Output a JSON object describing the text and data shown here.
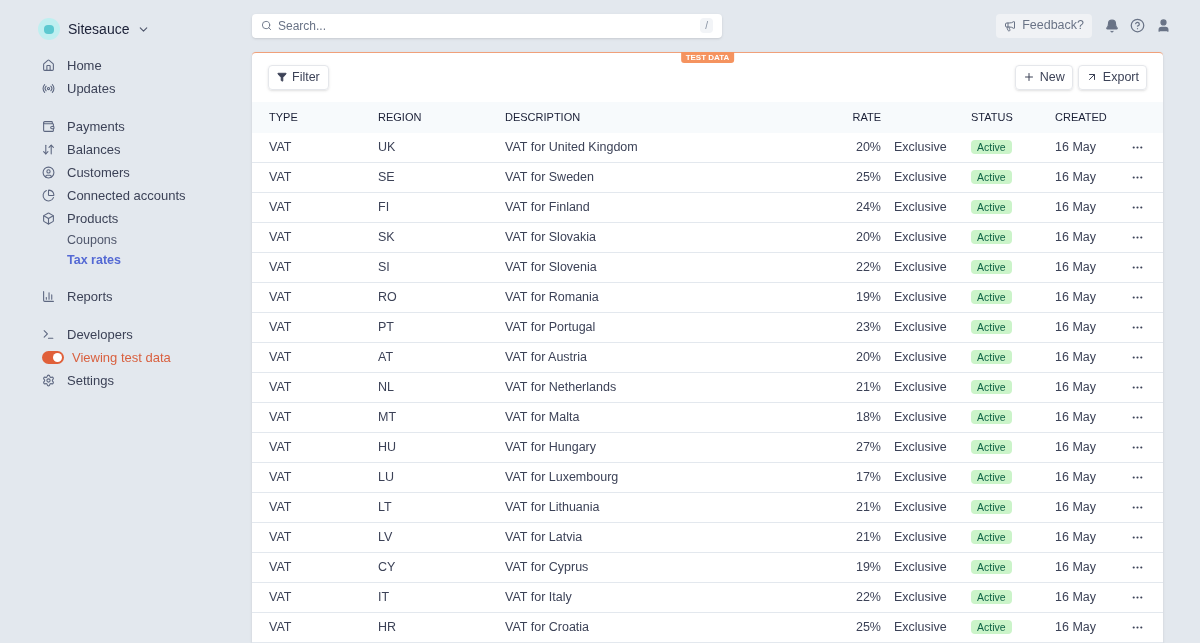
{
  "brand": {
    "name": "Sitesauce"
  },
  "sidebar": {
    "groups": [
      {
        "items": [
          {
            "label": "Home",
            "kind": "main",
            "selected": false
          },
          {
            "label": "Updates",
            "kind": "main",
            "selected": false
          }
        ]
      },
      {
        "items": [
          {
            "label": "Payments",
            "kind": "main",
            "selected": false
          },
          {
            "label": "Balances",
            "kind": "main",
            "selected": false
          },
          {
            "label": "Customers",
            "kind": "main",
            "selected": false
          },
          {
            "label": "Connected accounts",
            "kind": "main",
            "selected": false
          },
          {
            "label": "Products",
            "kind": "main",
            "selected": false
          },
          {
            "label": "Coupons",
            "kind": "sub",
            "selected": false
          },
          {
            "label": "Tax rates",
            "kind": "sub",
            "selected": true
          }
        ]
      },
      {
        "items": [
          {
            "label": "Reports",
            "kind": "main",
            "selected": false
          }
        ]
      },
      {
        "items": [
          {
            "label": "Developers",
            "kind": "main",
            "selected": false
          },
          {
            "label": "Viewing test data",
            "kind": "toggle",
            "on": true,
            "selected": false
          },
          {
            "label": "Settings",
            "kind": "main",
            "selected": false
          }
        ]
      }
    ]
  },
  "search": {
    "placeholder": "Search...",
    "shortcut": "/"
  },
  "topbar": {
    "feedback": "Feedback?"
  },
  "card": {
    "badge": "TEST DATA",
    "filter": "Filter",
    "new": "New",
    "export": "Export"
  },
  "table": {
    "columns": [
      "TYPE",
      "REGION",
      "DESCRIPTION",
      "RATE",
      "STATUS",
      "CREATED"
    ],
    "rows": [
      {
        "type": "VAT",
        "region": "UK",
        "description": "VAT for United Kingdom",
        "rate": "20%",
        "inclusion": "Exclusive",
        "status": "Active",
        "created": "16 May"
      },
      {
        "type": "VAT",
        "region": "SE",
        "description": "VAT for Sweden",
        "rate": "25%",
        "inclusion": "Exclusive",
        "status": "Active",
        "created": "16 May"
      },
      {
        "type": "VAT",
        "region": "FI",
        "description": "VAT for Finland",
        "rate": "24%",
        "inclusion": "Exclusive",
        "status": "Active",
        "created": "16 May"
      },
      {
        "type": "VAT",
        "region": "SK",
        "description": "VAT for Slovakia",
        "rate": "20%",
        "inclusion": "Exclusive",
        "status": "Active",
        "created": "16 May"
      },
      {
        "type": "VAT",
        "region": "SI",
        "description": "VAT for Slovenia",
        "rate": "22%",
        "inclusion": "Exclusive",
        "status": "Active",
        "created": "16 May"
      },
      {
        "type": "VAT",
        "region": "RO",
        "description": "VAT for Romania",
        "rate": "19%",
        "inclusion": "Exclusive",
        "status": "Active",
        "created": "16 May"
      },
      {
        "type": "VAT",
        "region": "PT",
        "description": "VAT for Portugal",
        "rate": "23%",
        "inclusion": "Exclusive",
        "status": "Active",
        "created": "16 May"
      },
      {
        "type": "VAT",
        "region": "AT",
        "description": "VAT for Austria",
        "rate": "20%",
        "inclusion": "Exclusive",
        "status": "Active",
        "created": "16 May"
      },
      {
        "type": "VAT",
        "region": "NL",
        "description": "VAT for Netherlands",
        "rate": "21%",
        "inclusion": "Exclusive",
        "status": "Active",
        "created": "16 May"
      },
      {
        "type": "VAT",
        "region": "MT",
        "description": "VAT for Malta",
        "rate": "18%",
        "inclusion": "Exclusive",
        "status": "Active",
        "created": "16 May"
      },
      {
        "type": "VAT",
        "region": "HU",
        "description": "VAT for Hungary",
        "rate": "27%",
        "inclusion": "Exclusive",
        "status": "Active",
        "created": "16 May"
      },
      {
        "type": "VAT",
        "region": "LU",
        "description": "VAT for Luxembourg",
        "rate": "17%",
        "inclusion": "Exclusive",
        "status": "Active",
        "created": "16 May"
      },
      {
        "type": "VAT",
        "region": "LT",
        "description": "VAT for Lithuania",
        "rate": "21%",
        "inclusion": "Exclusive",
        "status": "Active",
        "created": "16 May"
      },
      {
        "type": "VAT",
        "region": "LV",
        "description": "VAT for Latvia",
        "rate": "21%",
        "inclusion": "Exclusive",
        "status": "Active",
        "created": "16 May"
      },
      {
        "type": "VAT",
        "region": "CY",
        "description": "VAT for Cyprus",
        "rate": "19%",
        "inclusion": "Exclusive",
        "status": "Active",
        "created": "16 May"
      },
      {
        "type": "VAT",
        "region": "IT",
        "description": "VAT for Italy",
        "rate": "22%",
        "inclusion": "Exclusive",
        "status": "Active",
        "created": "16 May"
      },
      {
        "type": "VAT",
        "region": "HR",
        "description": "VAT for Croatia",
        "rate": "25%",
        "inclusion": "Exclusive",
        "status": "Active",
        "created": "16 May"
      }
    ]
  }
}
